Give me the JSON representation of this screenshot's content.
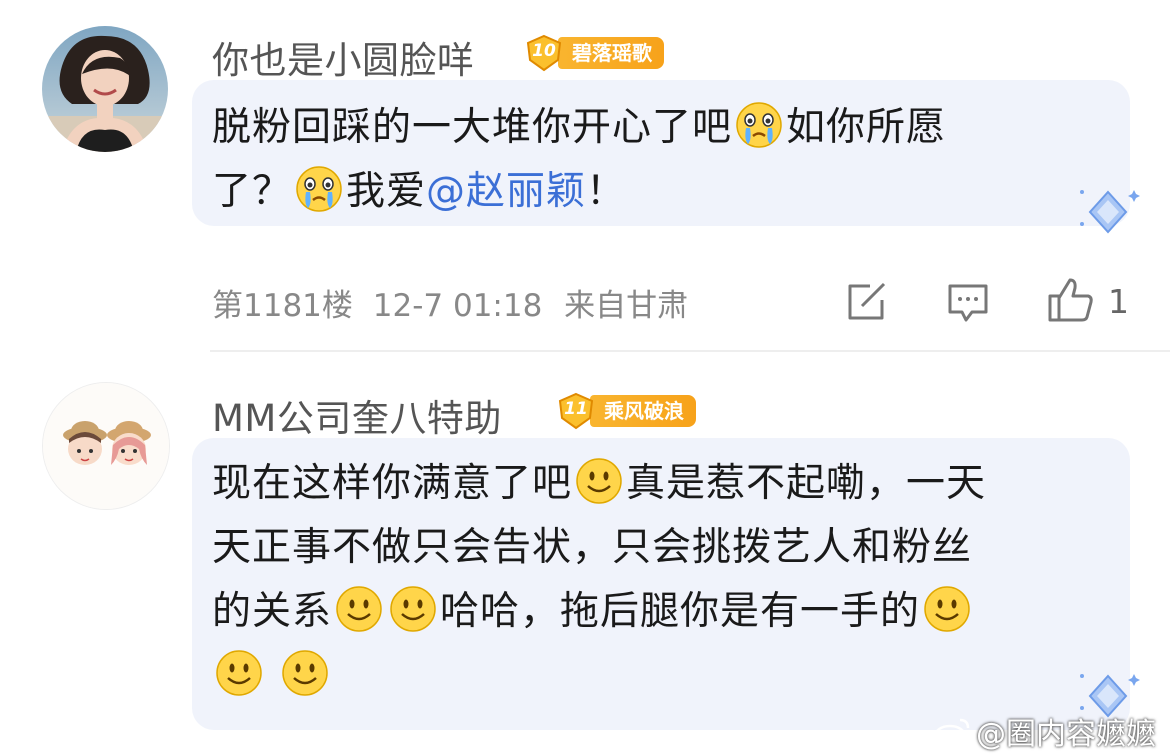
{
  "comments": [
    {
      "username": "你也是小圆脸咩",
      "badge_level": "10",
      "badge_title": "碧落瑶歌",
      "text_line1_a": "脱粉回踩的一大堆你开心了吧",
      "text_line1_b": "如你所愿",
      "text_line2_a": "了？",
      "text_line2_b": "我爱",
      "mention": "@赵丽颖",
      "text_line2_c": "！",
      "floor": "第1181楼",
      "time": "12-7 01:18",
      "location": "来自甘肃",
      "like_count": "1",
      "emoji": "crying-emoji"
    },
    {
      "username": "MM公司奎八特助",
      "badge_level": "11",
      "badge_title": "乘风破浪",
      "line1_a": "现在这样你满意了吧",
      "line1_b": "真是惹不起嘞，一天",
      "line2": "天正事不做只会告状，只会挑拨艺人和粉丝",
      "line3_a": "的关系",
      "line3_b": "哈哈，拖后腿你是有一手的",
      "emoji": "smile-emoji"
    }
  ],
  "watermark": "@圈内容嬷嬷",
  "colors": {
    "mention": "#3b6fd6",
    "badge": "#f7a21a",
    "bubble": "#f0f3fb"
  }
}
